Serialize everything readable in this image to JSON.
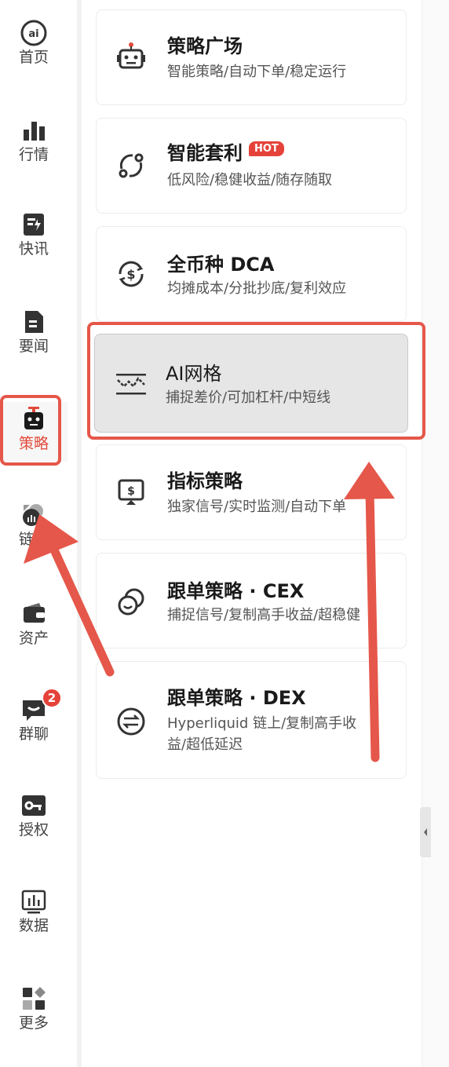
{
  "sidebar": {
    "items": [
      {
        "label": "首页",
        "icon": "home-logo-icon"
      },
      {
        "label": "行情",
        "icon": "bar-chart-icon"
      },
      {
        "label": "快讯",
        "icon": "flash-news-icon"
      },
      {
        "label": "要闻",
        "icon": "document-icon"
      },
      {
        "label": "策略",
        "icon": "robot-icon"
      },
      {
        "label": "链上",
        "icon": "chain-data-icon"
      },
      {
        "label": "资产",
        "icon": "wallet-icon"
      },
      {
        "label": "群聊",
        "icon": "chat-icon",
        "badge": "2"
      },
      {
        "label": "授权",
        "icon": "key-icon"
      },
      {
        "label": "数据",
        "icon": "data-chart-icon"
      },
      {
        "label": "更多",
        "icon": "grid-more-icon"
      }
    ]
  },
  "strategies": [
    {
      "title": "策略广场",
      "subtitle": "智能策略/自动下单/稳定运行",
      "icon": "robot-icon"
    },
    {
      "title": "智能套利",
      "subtitle": "低风险/稳健收益/随存随取",
      "icon": "cycle-arrows-icon",
      "badge": "HOT"
    },
    {
      "title": "全币种 DCA",
      "subtitle": "均摊成本/分批抄底/复利效应",
      "icon": "dollar-cycle-icon"
    },
    {
      "title": "AI网格",
      "subtitle": "捕捉差价/可加杠杆/中短线",
      "icon": "grid-wave-icon"
    },
    {
      "title": "指标策略",
      "subtitle": "独家信号/实时监测/自动下单",
      "icon": "signal-screen-icon"
    },
    {
      "title": "跟单策略 · CEX",
      "subtitle": "捕捉信号/复制高手收益/超稳健",
      "icon": "copy-circles-icon"
    },
    {
      "title": "跟单策略 · DEX",
      "subtitle": "Hyperliquid 链上/复制高手收",
      "subtitle2": "益/超低延迟",
      "icon": "swap-circle-icon"
    }
  ],
  "colors": {
    "accent": "#e24a3b",
    "highlight": "#e5574a",
    "selected_card": "#e6e6e6"
  }
}
